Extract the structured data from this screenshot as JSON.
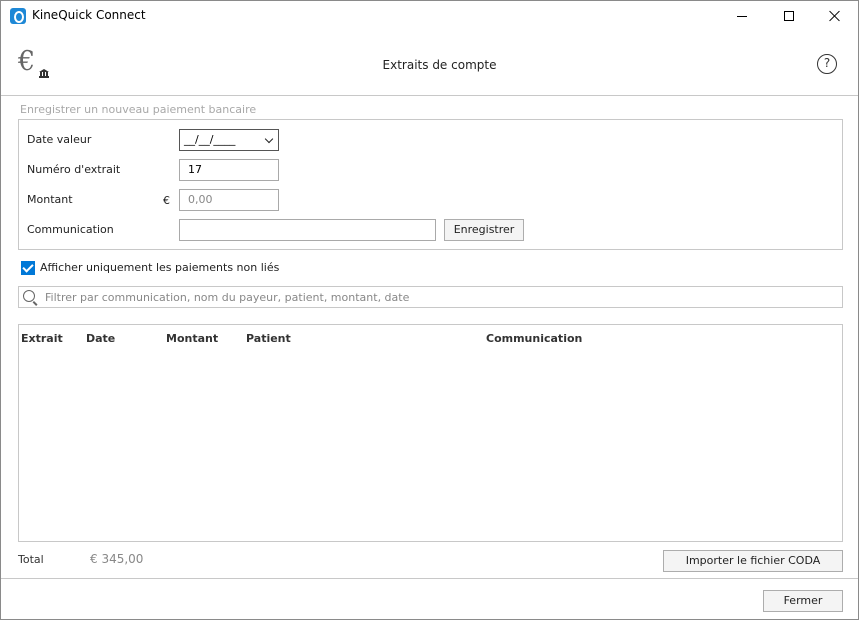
{
  "window": {
    "app_title": "KineQuick Connect"
  },
  "header": {
    "title": "Extraits de compte",
    "help_symbol": "?",
    "currency_symbol": "€"
  },
  "form": {
    "legend": "Enregistrer un nouveau paiement bancaire",
    "date_label": "Date valeur",
    "date_value": "__/__/____",
    "extrait_label": "Numéro d'extrait",
    "extrait_value": "17",
    "montant_label": "Montant",
    "montant_currency": "€",
    "montant_value": "0,00",
    "communication_label": "Communication",
    "communication_value": "",
    "save_button": "Enregistrer"
  },
  "filters": {
    "unlinked_only_label": "Afficher uniquement les paiements non liés",
    "unlinked_only_checked": true,
    "search_placeholder": "Filtrer par communication, nom du payeur, patient, montant, date"
  },
  "table": {
    "columns": [
      "Extrait",
      "Date",
      "Montant",
      "Patient",
      "Communication"
    ],
    "rows": []
  },
  "footer": {
    "total_label": "Total",
    "total_value": "€ 345,00",
    "import_button": "Importer le fichier CODA",
    "close_button": "Fermer"
  },
  "icons": {
    "app_logo": "kinequick-logo-icon",
    "header": "euro-bank-icon",
    "help": "help-icon",
    "search": "search-icon"
  },
  "colors": {
    "accent": "#0078d7",
    "app_logo": "#1e88d6",
    "border": "#c8c8c8",
    "muted_text": "#888888"
  }
}
